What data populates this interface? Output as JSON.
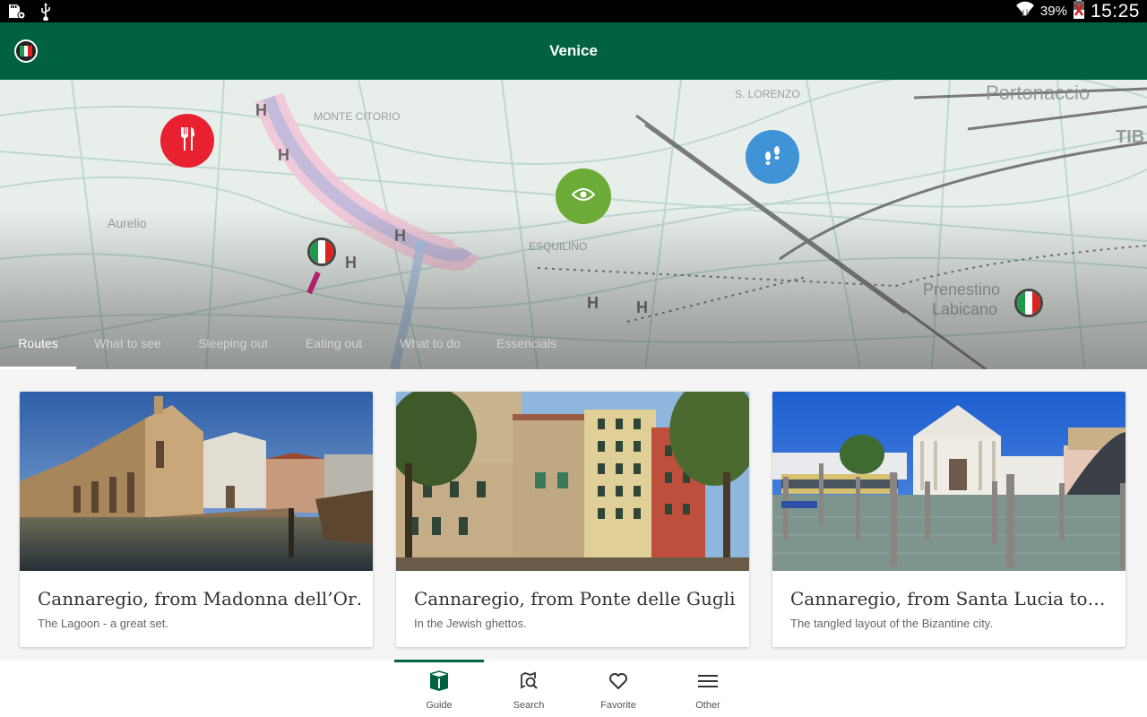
{
  "status_bar": {
    "left_icons": [
      "sd-card-settings-icon",
      "usb-icon"
    ],
    "battery_percent": "39%",
    "time": "15:25",
    "right_icons": [
      "wifi-icon",
      "battery-charging-icon"
    ]
  },
  "app_bar": {
    "title": "Venice",
    "logo": "app-logo-italian-flag"
  },
  "map_header": {
    "pins": [
      {
        "type": "eating",
        "icon": "fork-knife-icon",
        "color": "#e8202f"
      },
      {
        "type": "what-to-see",
        "icon": "eye-icon",
        "color": "#6cab38"
      },
      {
        "type": "what-to-do",
        "icon": "footprints-icon",
        "color": "#3f93d6"
      },
      {
        "type": "route-start",
        "icon": "italian-flag-icon"
      },
      {
        "type": "route-end",
        "icon": "italian-flag-icon"
      }
    ],
    "map_labels": [
      "Portonaccio",
      "TIB"
    ]
  },
  "tabs": [
    {
      "label": "Routes",
      "active": true
    },
    {
      "label": "What to see",
      "active": false
    },
    {
      "label": "Sleeping out",
      "active": false
    },
    {
      "label": "Eating out",
      "active": false
    },
    {
      "label": "What to do",
      "active": false
    },
    {
      "label": "Essencials",
      "active": false
    }
  ],
  "routes": [
    {
      "title": "Cannaregio, from Madonna dell’Or…",
      "subtitle": "The Lagoon - a great set.",
      "image": "church-by-canal-photo"
    },
    {
      "title": "Cannaregio, from Ponte delle Gugli…",
      "subtitle": "In the Jewish ghettos.",
      "image": "ghetto-buildings-photo"
    },
    {
      "title": "Cannaregio, from Santa Lucia to…",
      "subtitle": "The tangled layout of the Bizantine city.",
      "image": "grand-canal-church-photo"
    }
  ],
  "bottom_nav": [
    {
      "label": "Guide",
      "icon": "book-icon",
      "active": true
    },
    {
      "label": "Search",
      "icon": "map-search-icon",
      "active": false
    },
    {
      "label": "Favorite",
      "icon": "heart-icon",
      "active": false
    },
    {
      "label": "Other",
      "icon": "menu-icon",
      "active": false
    }
  ],
  "colors": {
    "primary": "#006241",
    "status_bar": "#000000",
    "background": "#f5f5f5"
  }
}
